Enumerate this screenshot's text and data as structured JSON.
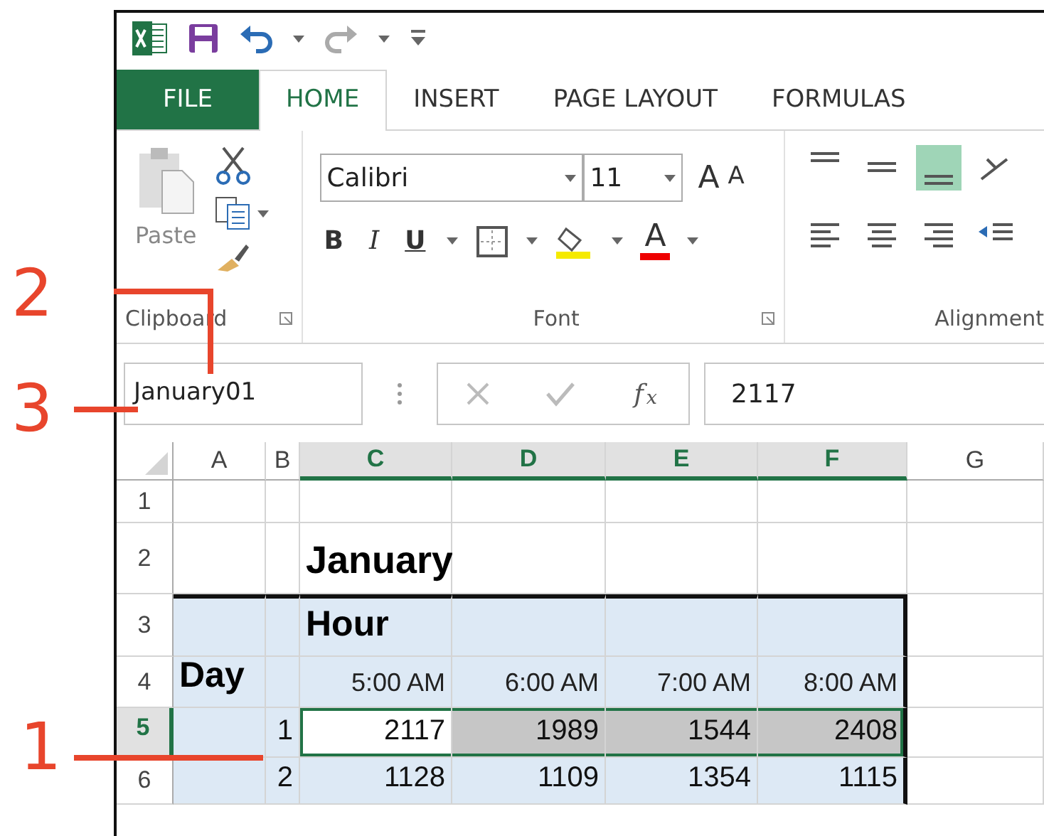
{
  "ribbon_tabs": [
    {
      "label": "FILE",
      "kind": "file",
      "selected": false
    },
    {
      "label": "HOME",
      "kind": "tab",
      "selected": true
    },
    {
      "label": "INSERT",
      "kind": "tab",
      "selected": false
    },
    {
      "label": "PAGE LAYOUT",
      "kind": "tab",
      "selected": false
    },
    {
      "label": "FORMULAS",
      "kind": "tab",
      "selected": false
    }
  ],
  "clipboard": {
    "paste_label": "Paste",
    "group_label": "Clipboard"
  },
  "font": {
    "name": "Calibri",
    "size": "11",
    "grow_label": "A",
    "shrink_label": "A",
    "bold_label": "B",
    "italic_label": "I",
    "underline_label": "U",
    "color_label": "A",
    "group_label": "Font"
  },
  "alignment": {
    "group_label": "Alignment",
    "buttons": [
      {
        "kind": "top",
        "selected": false
      },
      {
        "kind": "middle",
        "selected": false
      },
      {
        "kind": "bottom",
        "selected": true
      },
      {
        "kind": "orientation",
        "selected": false
      },
      {
        "kind": "left",
        "selected": false
      },
      {
        "kind": "center",
        "selected": false
      },
      {
        "kind": "right",
        "selected": false
      },
      {
        "kind": "indent",
        "selected": false
      }
    ]
  },
  "formula_bar": {
    "name_box": "January01",
    "function_label": "f$_{x}$",
    "formula": "2117"
  },
  "columns": [
    {
      "label": "A",
      "selected": false
    },
    {
      "label": "B",
      "selected": false
    },
    {
      "label": "C",
      "selected": true
    },
    {
      "label": "D",
      "selected": true
    },
    {
      "label": "E",
      "selected": true
    },
    {
      "label": "F",
      "selected": true
    },
    {
      "label": "G",
      "selected": false
    }
  ],
  "rows": [
    {
      "label": "1",
      "selected": false,
      "in_table": false,
      "cells": [
        {
          "selected": false,
          "active": false
        },
        {
          "selected": false,
          "active": false
        },
        {
          "selected": false,
          "active": false
        },
        {
          "selected": false,
          "active": false
        },
        {
          "selected": false,
          "active": false
        },
        {
          "selected": false,
          "active": false
        },
        {
          "selected": false,
          "active": false
        }
      ]
    },
    {
      "label": "2",
      "selected": false,
      "in_table": false,
      "cells": [
        {
          "selected": false,
          "active": false
        },
        {
          "selected": false,
          "active": false
        },
        {
          "text": "January",
          "kind": "title",
          "selected": false,
          "active": false
        },
        {
          "selected": false,
          "active": false
        },
        {
          "selected": false,
          "active": false
        },
        {
          "selected": false,
          "active": false
        },
        {
          "selected": false,
          "active": false
        }
      ]
    },
    {
      "label": "3",
      "selected": false,
      "in_table": true,
      "cells": [
        {
          "selected": false,
          "active": false
        },
        {
          "selected": false,
          "active": false
        },
        {
          "text": "Hour",
          "kind": "heading",
          "selected": false,
          "active": false
        },
        {
          "selected": false,
          "active": false
        },
        {
          "selected": false,
          "active": false
        },
        {
          "selected": false,
          "active": false
        },
        {
          "selected": false,
          "active": false
        }
      ]
    },
    {
      "label": "4",
      "selected": false,
      "in_table": true,
      "cells": [
        {
          "text": "Day",
          "kind": "heading",
          "selected": false,
          "active": false
        },
        {
          "selected": false,
          "active": false
        },
        {
          "text": "5:00 AM",
          "kind": "time",
          "selected": false,
          "active": false
        },
        {
          "text": "6:00 AM",
          "kind": "time",
          "selected": false,
          "active": false
        },
        {
          "text": "7:00 AM",
          "kind": "time",
          "selected": false,
          "active": false
        },
        {
          "text": "8:00 AM",
          "kind": "time",
          "selected": false,
          "active": false
        },
        {
          "selected": false,
          "active": false
        }
      ]
    },
    {
      "label": "5",
      "selected": true,
      "in_table": true,
      "cells": [
        {
          "selected": false,
          "active": false
        },
        {
          "text": "1",
          "kind": "number",
          "selected": false,
          "active": false
        },
        {
          "text": "2117",
          "kind": "number",
          "selected": true,
          "active": true
        },
        {
          "text": "1989",
          "kind": "number",
          "selected": true,
          "active": false
        },
        {
          "text": "1544",
          "kind": "number",
          "selected": true,
          "active": false
        },
        {
          "text": "2408",
          "kind": "number",
          "selected": true,
          "active": false
        },
        {
          "selected": false,
          "active": false
        }
      ]
    },
    {
      "label": "6",
      "selected": false,
      "in_table": true,
      "cells": [
        {
          "selected": false,
          "active": false
        },
        {
          "text": "2",
          "kind": "number",
          "selected": false,
          "active": false
        },
        {
          "text": "1128",
          "kind": "number",
          "selected": false,
          "active": false
        },
        {
          "text": "1109",
          "kind": "number",
          "selected": false,
          "active": false
        },
        {
          "text": "1354",
          "kind": "number",
          "selected": false,
          "active": false
        },
        {
          "text": "1115",
          "kind": "number",
          "selected": false,
          "active": false
        },
        {
          "selected": false,
          "active": false
        }
      ]
    }
  ],
  "callouts": [
    {
      "label": "2"
    },
    {
      "label": "3"
    },
    {
      "label": "1"
    }
  ]
}
